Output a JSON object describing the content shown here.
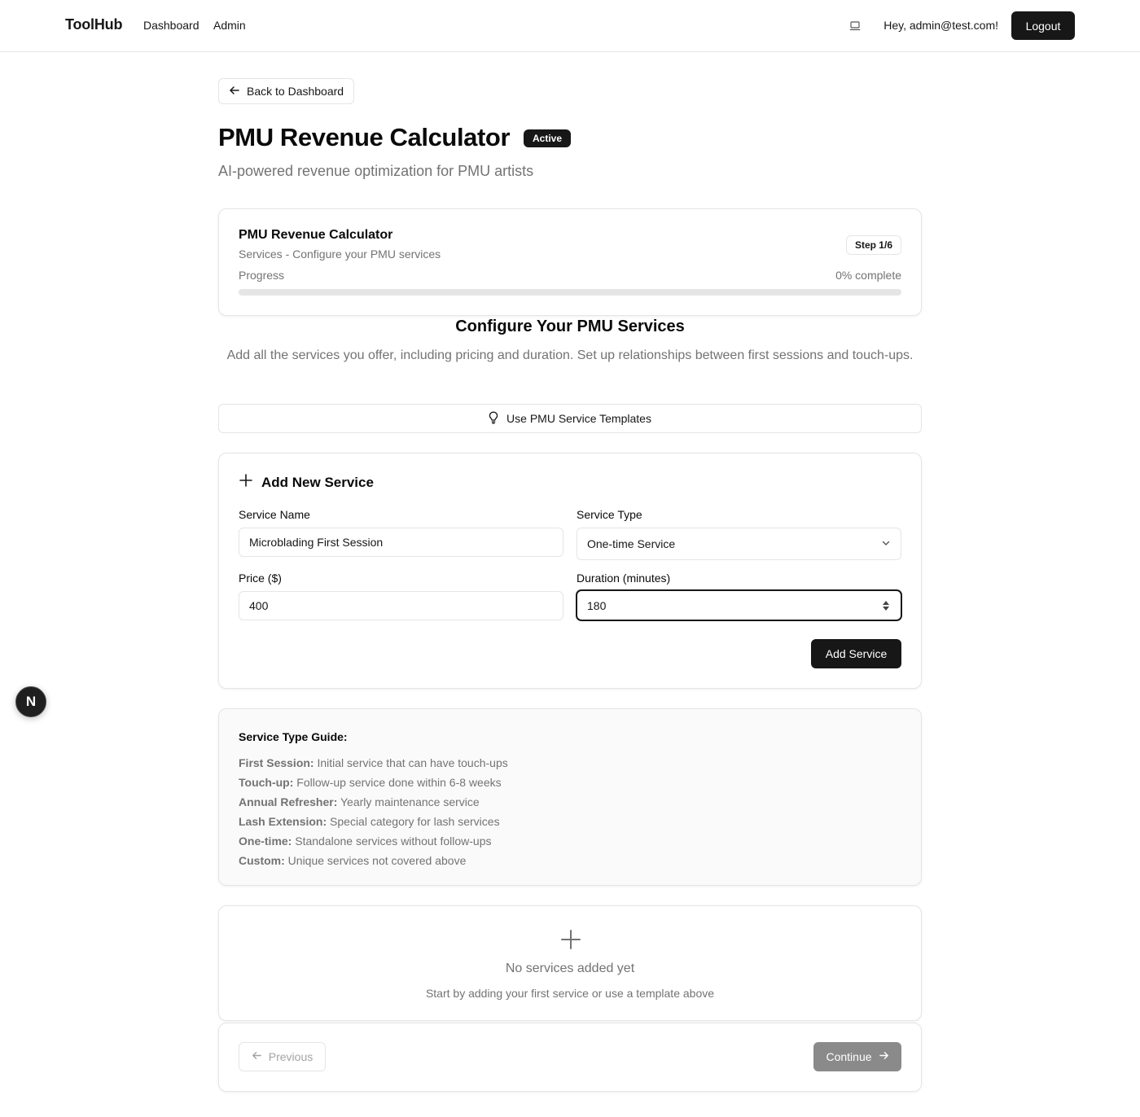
{
  "header": {
    "brand": "ToolHub",
    "nav": [
      "Dashboard",
      "Admin"
    ],
    "theme_icon": "laptop-icon",
    "greeting": "Hey, admin@test.com!",
    "logout_label": "Logout"
  },
  "back_button": {
    "label": "Back to Dashboard",
    "icon": "arrow-left-icon"
  },
  "page": {
    "title": "PMU Revenue Calculator",
    "status": "Active",
    "subtitle": "AI-powered revenue optimization for PMU artists"
  },
  "progress_card": {
    "title": "PMU Revenue Calculator",
    "subtitle": "Services - Configure your PMU services",
    "step": "Step 1/6",
    "progress_label": "Progress",
    "progress_text": "0% complete",
    "progress_percent": 0
  },
  "section": {
    "heading": "Configure Your PMU Services",
    "description": "Add all the services you offer, including pricing and duration. Set up relationships between first sessions and touch-ups."
  },
  "templates_button": {
    "label": "Use PMU Service Templates",
    "icon": "lightbulb-icon"
  },
  "add_service": {
    "title": "Add New Service",
    "icon": "plus-icon",
    "service_name_label": "Service Name",
    "service_name_value": "Microblading First Session",
    "service_type_label": "Service Type",
    "service_type_value": "One-time Service",
    "price_label": "Price ($)",
    "price_value": "400",
    "duration_label": "Duration (minutes)",
    "duration_value": "180",
    "submit_label": "Add Service"
  },
  "guide": {
    "title": "Service Type Guide:",
    "items": [
      {
        "term": "First Session:",
        "desc": "Initial service that can have touch-ups"
      },
      {
        "term": "Touch-up:",
        "desc": "Follow-up service done within 6-8 weeks"
      },
      {
        "term": "Annual Refresher:",
        "desc": "Yearly maintenance service"
      },
      {
        "term": "Lash Extension:",
        "desc": "Special category for lash services"
      },
      {
        "term": "One-time:",
        "desc": "Standalone services without follow-ups"
      },
      {
        "term": "Custom:",
        "desc": "Unique services not covered above"
      }
    ]
  },
  "empty_state": {
    "title": "No services added yet",
    "subtitle": "Start by adding your first service or use a template above"
  },
  "navigation": {
    "previous_label": "Previous",
    "continue_label": "Continue"
  },
  "floating_badge": {
    "label": "N"
  },
  "colors": {
    "primary": "#171717",
    "muted_text": "#737373",
    "border": "#e5e5e5",
    "disabled": "#8a8a8a"
  }
}
